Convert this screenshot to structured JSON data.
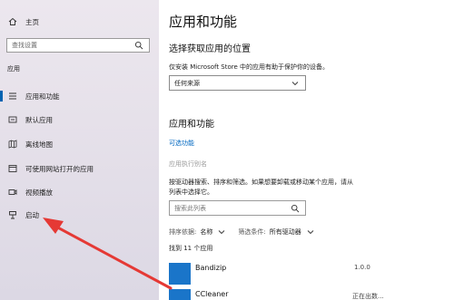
{
  "sidebar": {
    "home_label": "主页",
    "search_placeholder": "查找设置",
    "category_label": "应用",
    "items": [
      {
        "label": "应用和功能",
        "icon": "list-icon"
      },
      {
        "label": "默认应用",
        "icon": "default-apps-icon"
      },
      {
        "label": "离线地图",
        "icon": "map-icon"
      },
      {
        "label": "可使用网站打开的应用",
        "icon": "web-apps-icon"
      },
      {
        "label": "视频播放",
        "icon": "video-icon"
      },
      {
        "label": "启动",
        "icon": "startup-icon"
      }
    ],
    "active_index": 0
  },
  "main": {
    "title": "应用和功能",
    "source_heading": "选择获取应用的位置",
    "source_description": "仅安装 Microsoft Store 中的应用有助于保护你的设备。",
    "source_dropdown_value": "任何来源",
    "apps_heading": "应用和功能",
    "optional_features_link": "可选功能",
    "app_aliases_link": "应用执行别名",
    "list_description_line1": "按驱动器搜索、排序和筛选。如果想要卸载或移动某个应用，请从",
    "list_description_line2": "列表中选择它。",
    "list_search_placeholder": "搜索此列表",
    "sort_label": "排序依据:",
    "sort_value": "名称",
    "filter_label": "筛选条件:",
    "filter_value": "所有驱动器",
    "found_count": "找到 11 个应用",
    "apps": [
      {
        "name": "Bandizip",
        "meta": "1.0.0"
      },
      {
        "name": "CCleaner",
        "meta": "正在出数..."
      }
    ]
  },
  "colors": {
    "accent": "#0063b1",
    "link": "#0067c0",
    "app_tile": "#1a75c9",
    "annotation_arrow": "#e53935"
  }
}
